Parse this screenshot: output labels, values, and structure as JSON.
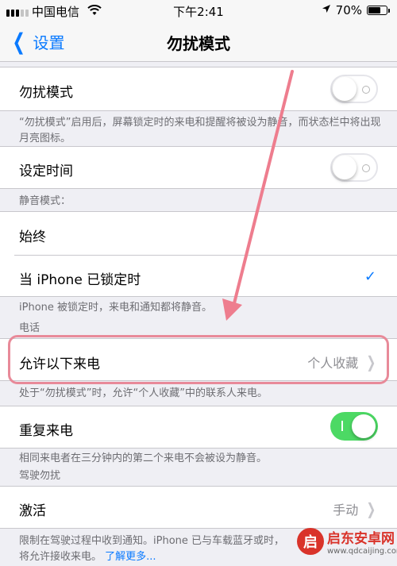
{
  "status_bar": {
    "carrier": "中国电信",
    "time": "下午2:41",
    "battery": "70%",
    "battery_level": 0.7,
    "wifi_icon": "wifi-icon",
    "location_icon": "location-arrow-icon"
  },
  "nav": {
    "back_label": "设置",
    "title": "勿扰模式"
  },
  "dnd": {
    "label": "勿扰模式",
    "enabled": false,
    "note": "“勿扰模式”启用后，屏幕锁定时的来电和提醒将被设为静音，而状态栏中将出现月亮图标。"
  },
  "schedule": {
    "label": "设定时间",
    "enabled": false
  },
  "silence": {
    "header": "静音模式：",
    "options": [
      "始终",
      "当 iPhone 已锁定时"
    ],
    "selected": 1,
    "note": "iPhone 被锁定时，来电和通知都将静音。"
  },
  "phone": {
    "header": "电话",
    "allow_label": "允许以下来电",
    "allow_value": "个人收藏",
    "allow_note": "处于“勿扰模式”时，允许“个人收藏”中的联系人来电。",
    "repeat_label": "重复来电",
    "repeat_enabled": true,
    "repeat_note": "相同来电者在三分钟内的第二个来电不会被设为静音。"
  },
  "driving": {
    "header": "驾驶勿扰",
    "activate_label": "激活",
    "activate_value": "手动",
    "note": "限制在驾驶过程中收到通知。iPhone 已与车载蓝牙或时，将允许接收来电。",
    "learn_more": "了解更多..."
  },
  "watermark": {
    "logo_char": "启",
    "name": "启东安卓网",
    "url": "www.qdcaijing.com"
  },
  "colors": {
    "accent": "#0a7aff",
    "toggle_on": "#4cd964",
    "highlight": "#e88a99",
    "arrow": "#ee7d8e"
  }
}
